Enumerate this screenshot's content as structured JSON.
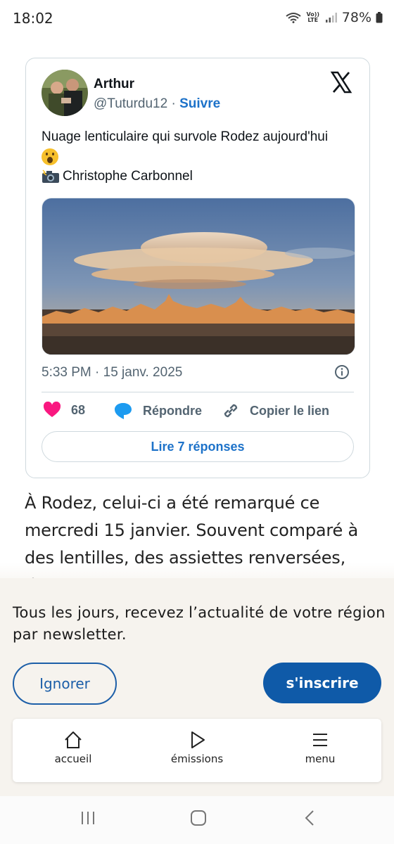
{
  "status_bar": {
    "time": "18:02",
    "volte": "Vo)) LTE",
    "battery": "78%"
  },
  "tweet": {
    "author_name": "Arthur",
    "handle": "@Tuturdu12",
    "separator": "·",
    "follow_label": "Suivre",
    "text_line1": "Nuage lenticulaire qui survole Rodez aujourd'hui",
    "credit": "Christophe Carbonnel",
    "timestamp": "5:33 PM · 15 janv. 2025",
    "likes_count": "68",
    "reply_label": "Répondre",
    "copy_link_label": "Copier le lien",
    "read_replies_label": "Lire 7 réponses",
    "like_color": "#f91880",
    "reply_icon_color": "#1d9bf0"
  },
  "article": {
    "text": "À Rodez, celui-ci a été remarqué ce mercredi 15 janvier. Souvent comparé à des lentilles, des assiettes renversées, des"
  },
  "newsletter": {
    "message": "Tous les jours, recevez l’actualité de votre région par newsletter.",
    "ignore_label": "Ignorer",
    "subscribe_label": "s'inscrire",
    "accent_color": "#0f5aa8"
  },
  "bottom_nav": {
    "items": [
      {
        "label": "accueil",
        "icon": "home-icon"
      },
      {
        "label": "émissions",
        "icon": "play-icon"
      },
      {
        "label": "menu",
        "icon": "menu-icon"
      }
    ]
  }
}
